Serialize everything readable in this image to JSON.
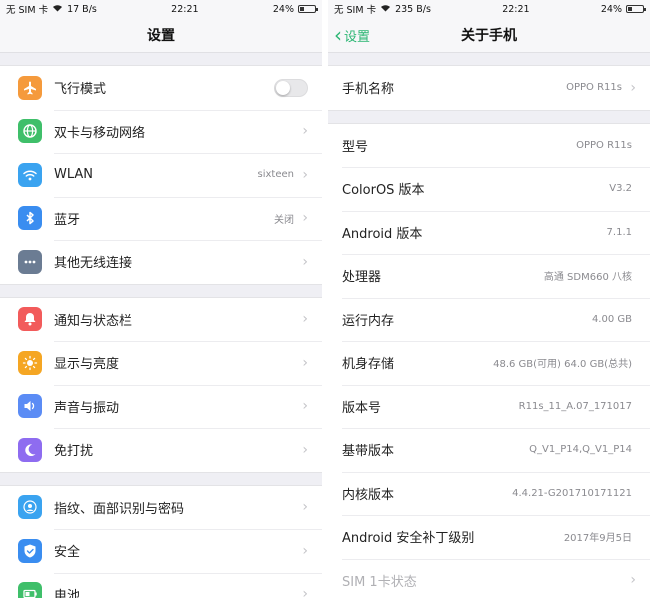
{
  "left": {
    "status": {
      "carrier": "无 SIM 卡",
      "speed": "17 B/s",
      "time": "22:21",
      "battery": "24%"
    },
    "title": "设置",
    "groups": [
      [
        {
          "label": "飞行模式",
          "icon": "airplane-icon",
          "color": "#f59a3c",
          "toggle_state": "off"
        },
        {
          "label": "双卡与移动网络",
          "icon": "globe-icon",
          "color": "#3fbf6a"
        },
        {
          "label": "WLAN",
          "icon": "wifi-icon",
          "color": "#3aa3f0",
          "value": "sixteen"
        },
        {
          "label": "蓝牙",
          "icon": "bluetooth-icon",
          "color": "#3a8df0",
          "value": "关闭"
        },
        {
          "label": "其他无线连接",
          "icon": "more-icon",
          "color": "#6b7c93"
        }
      ],
      [
        {
          "label": "通知与状态栏",
          "icon": "bell-icon",
          "color": "#f25b5b"
        },
        {
          "label": "显示与亮度",
          "icon": "brightness-icon",
          "color": "#f5a623"
        },
        {
          "label": "声音与振动",
          "icon": "speaker-icon",
          "color": "#5b8cf5"
        },
        {
          "label": "免打扰",
          "icon": "moon-icon",
          "color": "#8e6cf0"
        }
      ],
      [
        {
          "label": "指纹、面部识别与密码",
          "icon": "fingerprint-icon",
          "color": "#3aa3f0"
        },
        {
          "label": "安全",
          "icon": "shield-icon",
          "color": "#3a8df0"
        },
        {
          "label": "电池",
          "icon": "battery-icon",
          "color": "#3fbf6a"
        }
      ]
    ]
  },
  "right": {
    "status": {
      "carrier": "无 SIM 卡",
      "speed": "235 B/s",
      "time": "22:21",
      "battery": "24%"
    },
    "back_label": "设置",
    "title": "关于手机",
    "group1": [
      {
        "label": "手机名称",
        "value": "OPPO R11s"
      }
    ],
    "group2": [
      {
        "label": "型号",
        "value": "OPPO R11s"
      },
      {
        "label": "ColorOS 版本",
        "value": "V3.2"
      },
      {
        "label": "Android 版本",
        "value": "7.1.1"
      },
      {
        "label": "处理器",
        "value": "高通 SDM660 八核"
      },
      {
        "label": "运行内存",
        "value": "4.00 GB"
      },
      {
        "label": "机身存储",
        "value": "48.6 GB(可用)   64.0 GB(总共)"
      },
      {
        "label": "版本号",
        "value": "R11s_11_A.07_171017"
      },
      {
        "label": "基带版本",
        "value": "Q_V1_P14,Q_V1_P14"
      },
      {
        "label": "内核版本",
        "value": "4.4.21-G201710171121"
      },
      {
        "label": "Android 安全补丁级别",
        "value": "2017年9月5日"
      },
      {
        "label": "SIM 1卡状态",
        "value": ""
      }
    ]
  }
}
